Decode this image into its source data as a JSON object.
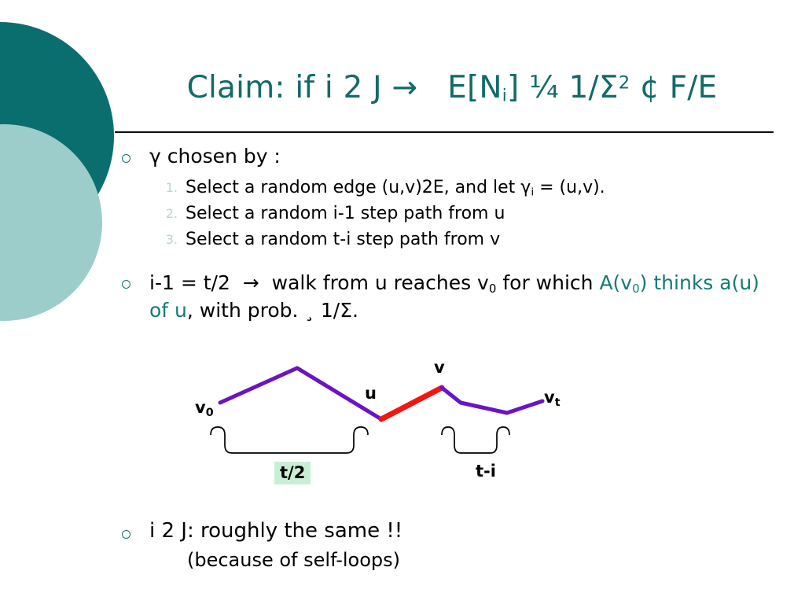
{
  "slide": {
    "title_parts": {
      "lead": "Claim: if i 2 J",
      "arrow": "→",
      "expr_a": "E[N",
      "expr_a_sub": "i",
      "expr_b": "] ¼ 1/Σ",
      "expr_b_sup": "2",
      "expr_c": "¢ F/E"
    },
    "title_plain": "Claim: if i 2 J → E[Ni] ¼ 1/Σ2 ¢ F/E",
    "bullet1": {
      "marker": "hollow-circle-bullet",
      "text": "γ chosen by :",
      "steps": [
        {
          "number": "1.",
          "text_before": "Select a random edge (u,v)2E, and let γ",
          "sub": "i",
          "text_after": " = (u,v)."
        },
        {
          "number": "2.",
          "text_before": "Select a random i-1 step path from u",
          "sub": "",
          "text_after": ""
        },
        {
          "number": "3.",
          "text_before": "Select a random t-i step path from v",
          "sub": "",
          "text_after": ""
        }
      ]
    },
    "bullet2": {
      "marker": "hollow-circle-bullet",
      "seg1": "i-1 = t/2",
      "arrow": "→",
      "seg2": "walk from u reaches v",
      "seg2_sub": "0",
      "seg3": " for which ",
      "teal1": "A(v",
      "teal1_sub": "0",
      "teal1_end": ")",
      "teal2": "thinks a(u) of u",
      "seg4": ", with prob. ¸ 1/Σ."
    },
    "bullet3": {
      "marker": "hollow-circle-bullet",
      "text": "i 2 J: roughly the same !!",
      "subtext": "(because of self-loops)"
    },
    "diagram": {
      "labels": {
        "v0": "v",
        "v0_sub": "0",
        "u": "u",
        "v": "v",
        "vt": "v",
        "vt_sub": "t",
        "brace_left": "t/2",
        "brace_right": "t-i"
      },
      "colors": {
        "walk_path": "#6a14c4",
        "highlight_edge": "#f5150d",
        "brace": "#000000",
        "label_highlight_bg": "#c8efd6"
      }
    },
    "decor": {
      "circle_dark": "#0b6e6e",
      "circle_light": "#9ccdcb",
      "title_color": "#116b69",
      "accent_teal": "#127c74",
      "number_color": "#b7d6d3"
    }
  }
}
